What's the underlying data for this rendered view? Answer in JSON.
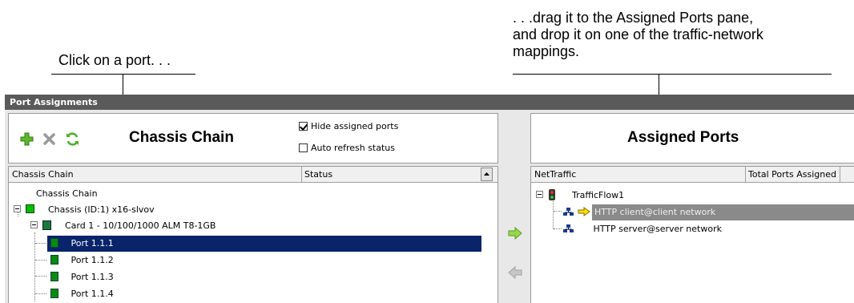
{
  "callouts": {
    "left": "Click on a port. . .",
    "right_lines": [
      ". . .drag it to the Assigned Ports pane,",
      "and drop it on one of the traffic-network",
      "mappings."
    ]
  },
  "window": {
    "title": "Port Assignments"
  },
  "chassis_panel": {
    "heading": "Chassis Chain",
    "hide_assigned_label": "Hide assigned ports",
    "hide_assigned_checked": true,
    "auto_refresh_label": "Auto refresh status",
    "auto_refresh_checked": false,
    "columns": [
      "Chassis Chain",
      "Status"
    ],
    "tree": {
      "root": "Chassis Chain",
      "chassis": "Chassis (ID:1) x16-slvov",
      "card": "Card 1 - 10/100/1000 ALM T8-1GB",
      "ports": [
        "Port 1.1.1",
        "Port 1.1.2",
        "Port 1.1.3",
        "Port 1.1.4"
      ],
      "selected_port": "Port 1.1.1"
    }
  },
  "assigned_panel": {
    "heading": "Assigned Ports",
    "columns": [
      "NetTraffic",
      "Total Ports Assigned"
    ],
    "tree": {
      "flow": "TrafficFlow1",
      "mappings": [
        "HTTP client@client network",
        "HTTP server@server network"
      ],
      "highlighted": "HTTP client@client network"
    }
  },
  "colors": {
    "selection": "#0a246a",
    "drop_highlight": "#8a8a8a",
    "titlebar": "#5a5a5a",
    "status_green": "#00c000"
  },
  "icons": [
    "plus-icon",
    "delete-x-icon",
    "refresh-icon",
    "arrow-right-icon",
    "arrow-left-icon",
    "network-icon",
    "traffic-light-icon",
    "drop-arrow-icon"
  ]
}
